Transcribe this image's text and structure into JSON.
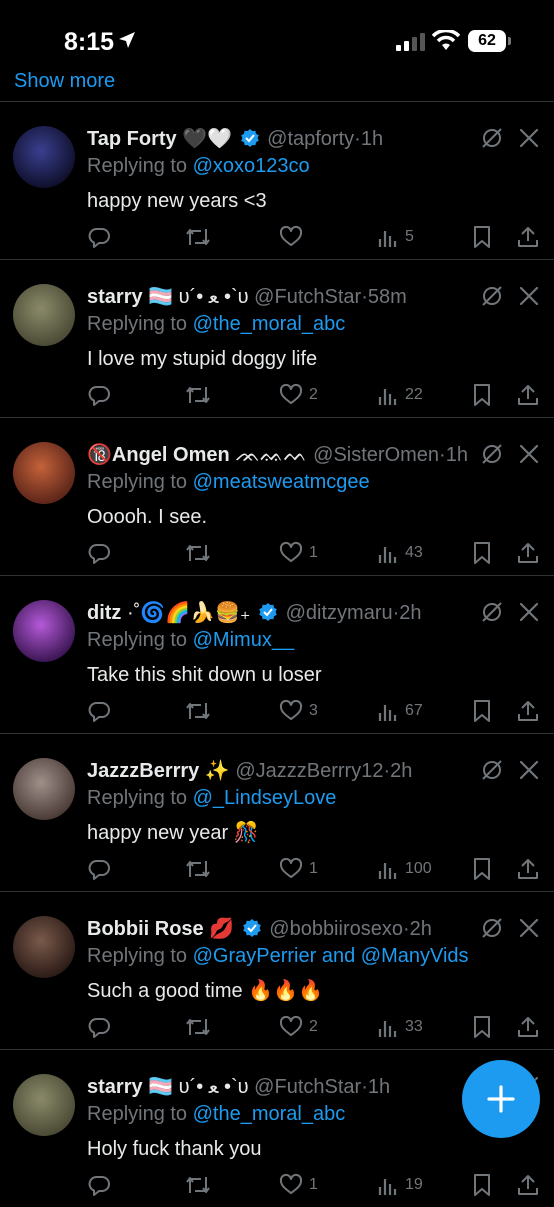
{
  "status_bar": {
    "time": "8:15",
    "battery": "62"
  },
  "show_more": "Show more",
  "tweets": [
    {
      "name": "Tap Forty",
      "name_emoji": "🖤🤍",
      "verified": true,
      "handle": "@tapforty",
      "ago": "1h",
      "reply_prefix": "Replying to",
      "mentions": [
        "@xoxo123co"
      ],
      "text": "happy new years <3",
      "likes": "",
      "views": "5",
      "avatar_colors": [
        "#3a3f8f",
        "#0e0f2a"
      ]
    },
    {
      "name": "starry",
      "name_emoji": "🏳️‍⚧️ υ´• ﻌ •`υ",
      "verified": false,
      "handle": "@FutchStar",
      "ago": "58m",
      "reply_prefix": "Replying to",
      "mentions": [
        "@the_moral_abc"
      ],
      "text": "I love my stupid doggy life",
      "likes": "2",
      "views": "22",
      "avatar_colors": [
        "#8a8a6a",
        "#4a4a35"
      ]
    },
    {
      "name": "Angel Omen",
      "name_prefix": "🔞",
      "name_emoji": "ᨏᨐᨓ",
      "verified": false,
      "handle": "@SisterOmen",
      "ago": "1h",
      "reply_prefix": "Replying to",
      "mentions": [
        "@meatsweatmcgee"
      ],
      "text": "Ooooh. I see.",
      "likes": "1",
      "views": "43",
      "avatar_colors": [
        "#c4623a",
        "#5a2418"
      ]
    },
    {
      "name": "ditz",
      "name_emoji": "·˚🌀🌈🍌🍔₊",
      "verified": true,
      "handle": "@ditzymaru",
      "ago": "2h",
      "reply_prefix": "Replying to",
      "mentions": [
        "@Mimux__"
      ],
      "text": "Take this shit down u loser",
      "likes": "3",
      "views": "67",
      "avatar_colors": [
        "#b45ad8",
        "#3a1552"
      ]
    },
    {
      "name": "JazzzBerrry",
      "name_emoji": "✨",
      "verified": false,
      "handle": "@JazzzBerrry12",
      "ago": "2h",
      "reply_prefix": "Replying to",
      "mentions": [
        "@_LindseyLove"
      ],
      "text": "happy new year 🎊",
      "likes": "1",
      "views": "100",
      "avatar_colors": [
        "#a0908a",
        "#4a3a36"
      ]
    },
    {
      "name": "Bobbii Rose",
      "name_emoji": "💋",
      "verified": true,
      "handle": "@bobbiirosexo",
      "ago": "2h",
      "reply_prefix": "Replying to",
      "mentions": [
        "@GrayPerrier",
        "@ManyVids"
      ],
      "mention_joiner": "and",
      "text": "Such a good time 🔥🔥🔥",
      "likes": "2",
      "views": "33",
      "avatar_colors": [
        "#7a5a4a",
        "#2a1a16"
      ]
    },
    {
      "name": "starry",
      "name_emoji": "🏳️‍⚧️ υ´• ﻌ •`υ",
      "verified": false,
      "handle": "@FutchStar",
      "ago": "1h",
      "reply_prefix": "Replying to",
      "mentions": [
        "@the_moral_abc"
      ],
      "text": "Holy fuck thank you",
      "likes": "1",
      "views": "19",
      "avatar_colors": [
        "#8a8a6a",
        "#4a4a35"
      ]
    }
  ],
  "colors": {
    "accent": "#1d9bf0",
    "muted": "#71767b",
    "text": "#e7e9ea",
    "divider": "#2f3336"
  }
}
